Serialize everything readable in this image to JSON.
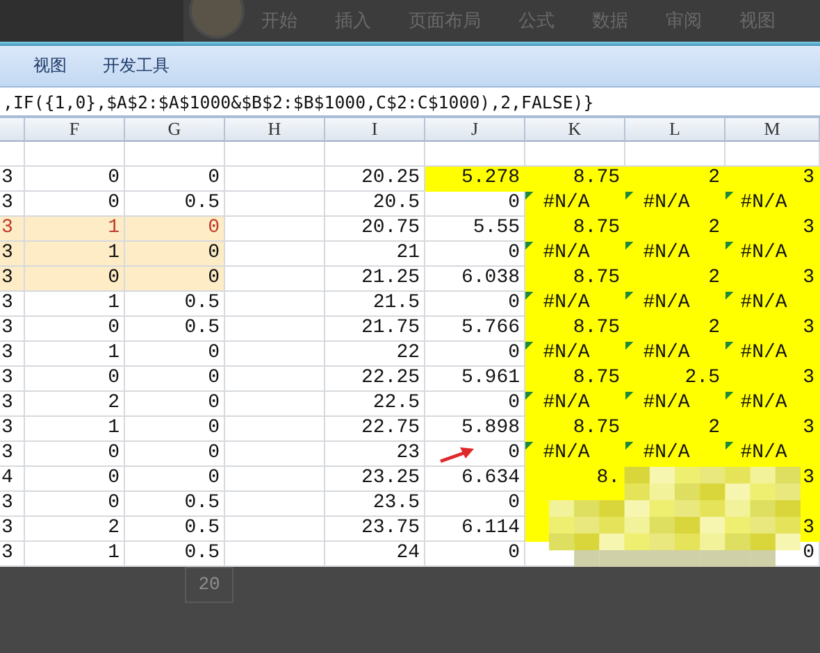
{
  "ribbon_tabs": [
    "开始",
    "插入",
    "页面布局",
    "公式",
    "数据",
    "审阅",
    "视图"
  ],
  "ribbon_groups": [
    "视图",
    "开发工具"
  ],
  "formula_bar": {
    "text": ",IF({1,0},$A$2:$A$1000&$B$2:$B$1000,C$2:C$1000),2,FALSE)}"
  },
  "columns": [
    "F",
    "G",
    "H",
    "I",
    "J",
    "K",
    "L",
    "M"
  ],
  "rows": [
    {
      "e": "3",
      "f": "0",
      "g": "0",
      "i": "20.25",
      "j": "5.278",
      "k": "8.75",
      "l": "2",
      "m": "3",
      "selected": false,
      "red_text": false,
      "yellow_j": true,
      "yellow_klm": true,
      "flagged": false
    },
    {
      "e": "3",
      "f": "0",
      "g": "0.5",
      "i": "20.5",
      "j": "0",
      "k": "#N/A",
      "l": "#N/A",
      "m": "#N/A",
      "selected": false,
      "red_text": false,
      "yellow_j": false,
      "yellow_klm": true,
      "flagged": true
    },
    {
      "e": "3",
      "f": "1",
      "g": "0",
      "i": "20.75",
      "j": "5.55",
      "k": "8.75",
      "l": "2",
      "m": "3",
      "selected": true,
      "red_text": true,
      "yellow_j": false,
      "yellow_klm": true,
      "flagged": false
    },
    {
      "e": "3",
      "f": "1",
      "g": "0",
      "i": "21",
      "j": "0",
      "k": "#N/A",
      "l": "#N/A",
      "m": "#N/A",
      "selected": true,
      "red_text": false,
      "yellow_j": false,
      "yellow_klm": true,
      "flagged": true
    },
    {
      "e": "3",
      "f": "0",
      "g": "0",
      "i": "21.25",
      "j": "6.038",
      "k": "8.75",
      "l": "2",
      "m": "3",
      "selected": true,
      "red_text": false,
      "yellow_j": false,
      "yellow_klm": true,
      "flagged": false
    },
    {
      "e": "3",
      "f": "1",
      "g": "0.5",
      "i": "21.5",
      "j": "0",
      "k": "#N/A",
      "l": "#N/A",
      "m": "#N/A",
      "selected": false,
      "red_text": false,
      "yellow_j": false,
      "yellow_klm": true,
      "flagged": true
    },
    {
      "e": "3",
      "f": "0",
      "g": "0.5",
      "i": "21.75",
      "j": "5.766",
      "k": "8.75",
      "l": "2",
      "m": "3",
      "selected": false,
      "red_text": false,
      "yellow_j": false,
      "yellow_klm": true,
      "flagged": false
    },
    {
      "e": "3",
      "f": "1",
      "g": "0",
      "i": "22",
      "j": "0",
      "k": "#N/A",
      "l": "#N/A",
      "m": "#N/A",
      "selected": false,
      "red_text": false,
      "yellow_j": false,
      "yellow_klm": true,
      "flagged": true
    },
    {
      "e": "3",
      "f": "0",
      "g": "0",
      "i": "22.25",
      "j": "5.961",
      "k": "8.75",
      "l": "2.5",
      "m": "3",
      "selected": false,
      "red_text": false,
      "yellow_j": false,
      "yellow_klm": true,
      "flagged": false
    },
    {
      "e": "3",
      "f": "2",
      "g": "0",
      "i": "22.5",
      "j": "0",
      "k": "#N/A",
      "l": "#N/A",
      "m": "#N/A",
      "selected": false,
      "red_text": false,
      "yellow_j": false,
      "yellow_klm": true,
      "flagged": true
    },
    {
      "e": "3",
      "f": "1",
      "g": "0",
      "i": "22.75",
      "j": "5.898",
      "k": "8.75",
      "l": "2",
      "m": "3",
      "selected": false,
      "red_text": false,
      "yellow_j": false,
      "yellow_klm": true,
      "flagged": false
    },
    {
      "e": "3",
      "f": "0",
      "g": "0",
      "i": "23",
      "j": "0",
      "k": "#N/A",
      "l": "#N/A",
      "m": "#N/A",
      "selected": false,
      "red_text": false,
      "yellow_j": false,
      "yellow_klm": true,
      "flagged": true
    },
    {
      "e": "4",
      "f": "0",
      "g": "0",
      "i": "23.25",
      "j": "6.634",
      "k": "8.",
      "m": "3",
      "selected": false,
      "red_text": false,
      "yellow_j": false,
      "yellow_klm": true,
      "flagged": false
    },
    {
      "e": "3",
      "f": "0",
      "g": "0.5",
      "i": "23.5",
      "j": "0",
      "selected": false,
      "red_text": false,
      "yellow_j": false,
      "yellow_klm": true,
      "flagged": false
    },
    {
      "e": "3",
      "f": "2",
      "g": "0.5",
      "i": "23.75",
      "j": "6.114",
      "m": "3",
      "selected": false,
      "red_text": false,
      "yellow_j": false,
      "yellow_klm": true,
      "flagged": false
    },
    {
      "e": "3",
      "f": "1",
      "g": "0.5",
      "i": "24",
      "j": "0",
      "m": "0",
      "selected": false,
      "red_text": false,
      "yellow_j": false,
      "yellow_klm": false,
      "flagged": false
    }
  ],
  "ghost_row_label": "20"
}
